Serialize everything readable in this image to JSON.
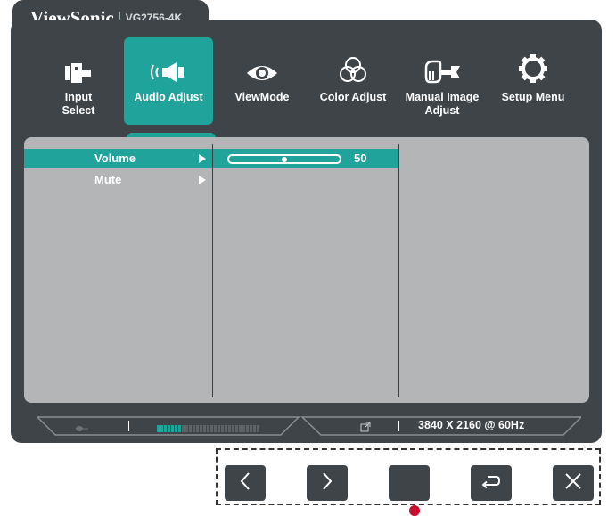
{
  "header": {
    "brand": "ViewSonic",
    "model": "VG2756-4K"
  },
  "menu": {
    "items": [
      {
        "label": "Input\nSelect",
        "icon": "input-select-icon"
      },
      {
        "label": "Audio Adjust",
        "icon": "audio-adjust-icon",
        "active": true
      },
      {
        "label": "ViewMode",
        "icon": "viewmode-icon"
      },
      {
        "label": "Color Adjust",
        "icon": "color-adjust-icon"
      },
      {
        "label": "Manual Image\nAdjust",
        "icon": "manual-image-adjust-icon"
      },
      {
        "label": "Setup Menu",
        "icon": "setup-menu-icon"
      }
    ]
  },
  "submenu": {
    "items": [
      {
        "label": "Volume",
        "selected": true
      },
      {
        "label": "Mute",
        "selected": false
      }
    ]
  },
  "volume": {
    "value": "50",
    "fraction": 0.5
  },
  "status": {
    "resolution": "3840 X 2160 @ 60Hz"
  },
  "colors": {
    "accent": "#1fa39a",
    "bezel": "#3f4448",
    "panel": "#b3b5b7"
  }
}
